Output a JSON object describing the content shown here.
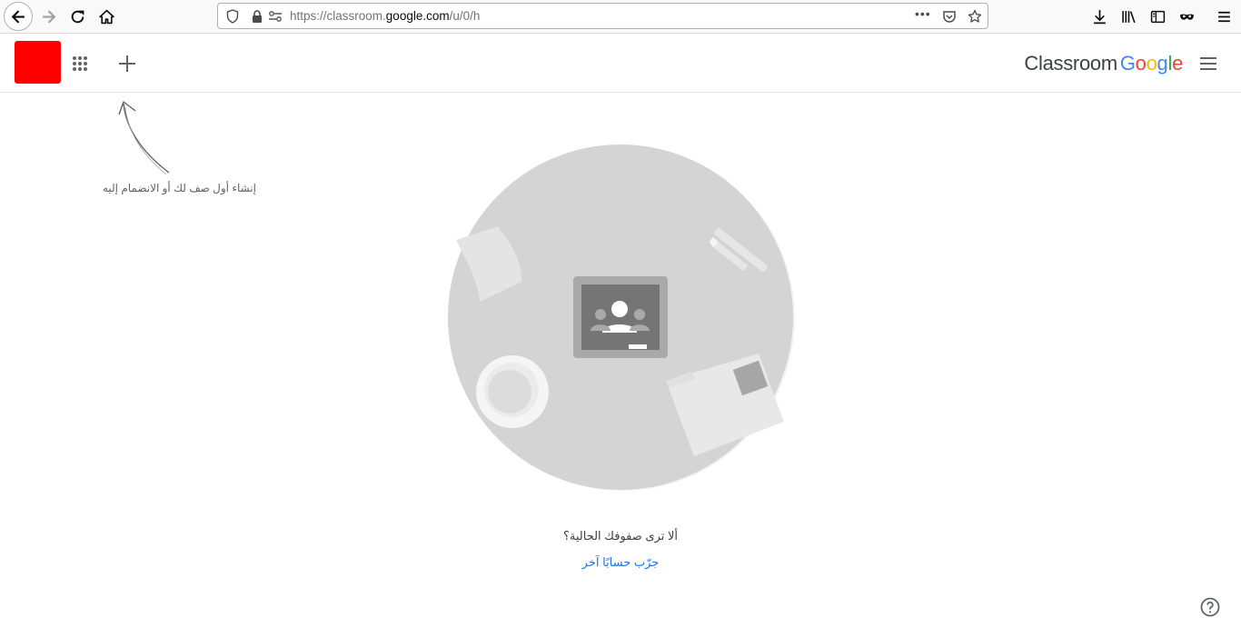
{
  "browser": {
    "url_prefix": "https://classroom.",
    "url_host": "google.com",
    "url_path": "/u/0/h",
    "more_label": "•••"
  },
  "header": {
    "brand_product": "Classroom",
    "brand_google": [
      "G",
      "o",
      "o",
      "g",
      "l",
      "e"
    ]
  },
  "hint": {
    "create_or_join": "إنشاء أول صف لك أو الانضمام إليه"
  },
  "empty_state": {
    "question": "ألا ترى صفوفك الحالية؟",
    "switch_account_link": "جرّب حسابًا آخر"
  },
  "colors": {
    "red_block": "#ff0000",
    "link": "#1a73e8",
    "illustration_bg": "#d4d4d4"
  }
}
